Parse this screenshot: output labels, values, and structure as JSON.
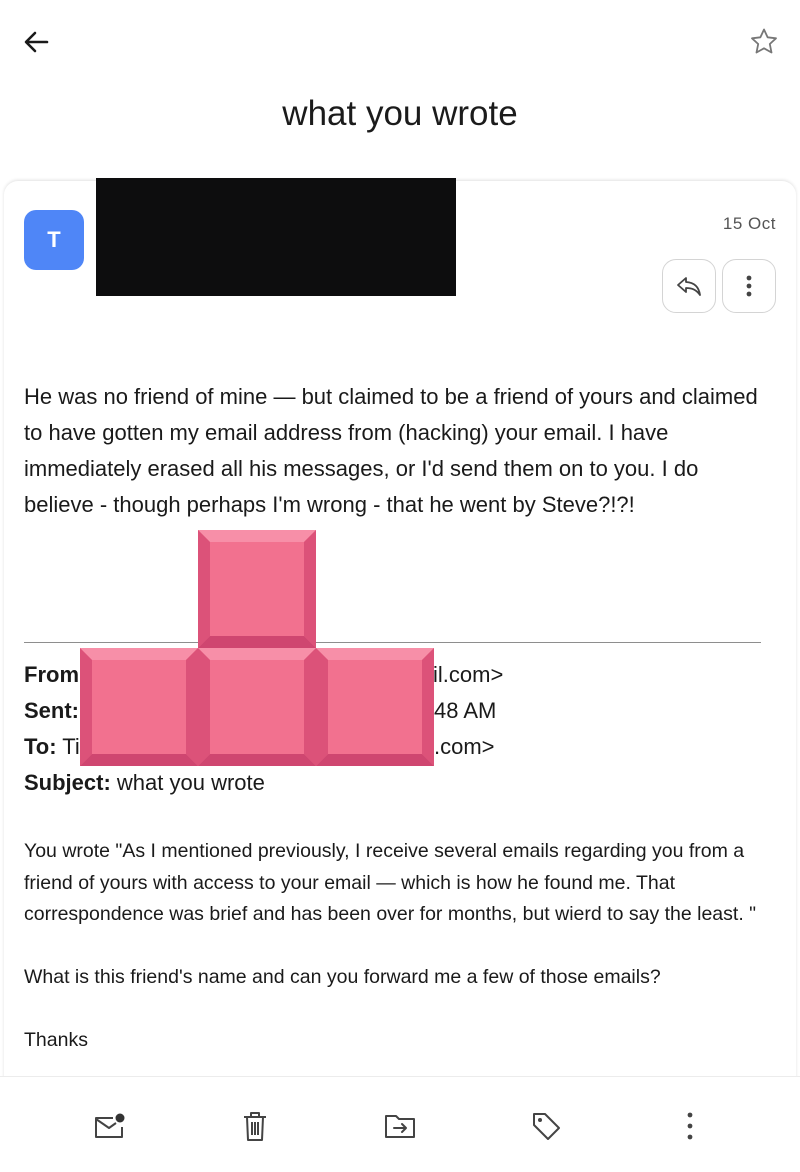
{
  "header": {
    "back_icon": "arrow-left-icon",
    "star_icon": "star-outline-icon",
    "subject": "what you wrote"
  },
  "message": {
    "avatar_letter": "T",
    "avatar_color": "#4f86f7",
    "date": "15 Oct",
    "body": "He was no friend of mine — but claimed to be a friend of yours and claimed to have gotten my email address from (hacking) your email. I have immediately erased all his messages, or I'd send them on to you.  I do believe - though perhaps I'm wrong - that he went by Steve?!?!"
  },
  "quoted_header": {
    "from_label": "From",
    "from_tail": "il.com>",
    "sent_label": "Sent:",
    "sent_tail": "48 AM",
    "to_label": "To:",
    "to_head": "Ti",
    "to_tail": ".com>",
    "subject_label": "Subject:",
    "subject_value": "what you wrote"
  },
  "quoted_body": {
    "para1": "You wrote \"As I mentioned previously, I receive several emails regarding you from a friend of yours with access to your email — which is how he found me.  That correspondence was brief and has been over for months, but wierd to say the least.  \"",
    "para2": "What is this friend's name and can you forward me a few of those emails?",
    "para3": "Thanks"
  },
  "bottom_bar": {
    "icons": [
      "mark-unread-icon",
      "trash-icon",
      "move-to-folder-icon",
      "label-tag-icon",
      "more-vertical-icon"
    ]
  },
  "colors": {
    "accent_blue": "#4f86f7",
    "redaction": "#0d0d0e",
    "tetris_pink": "#f2718f"
  }
}
